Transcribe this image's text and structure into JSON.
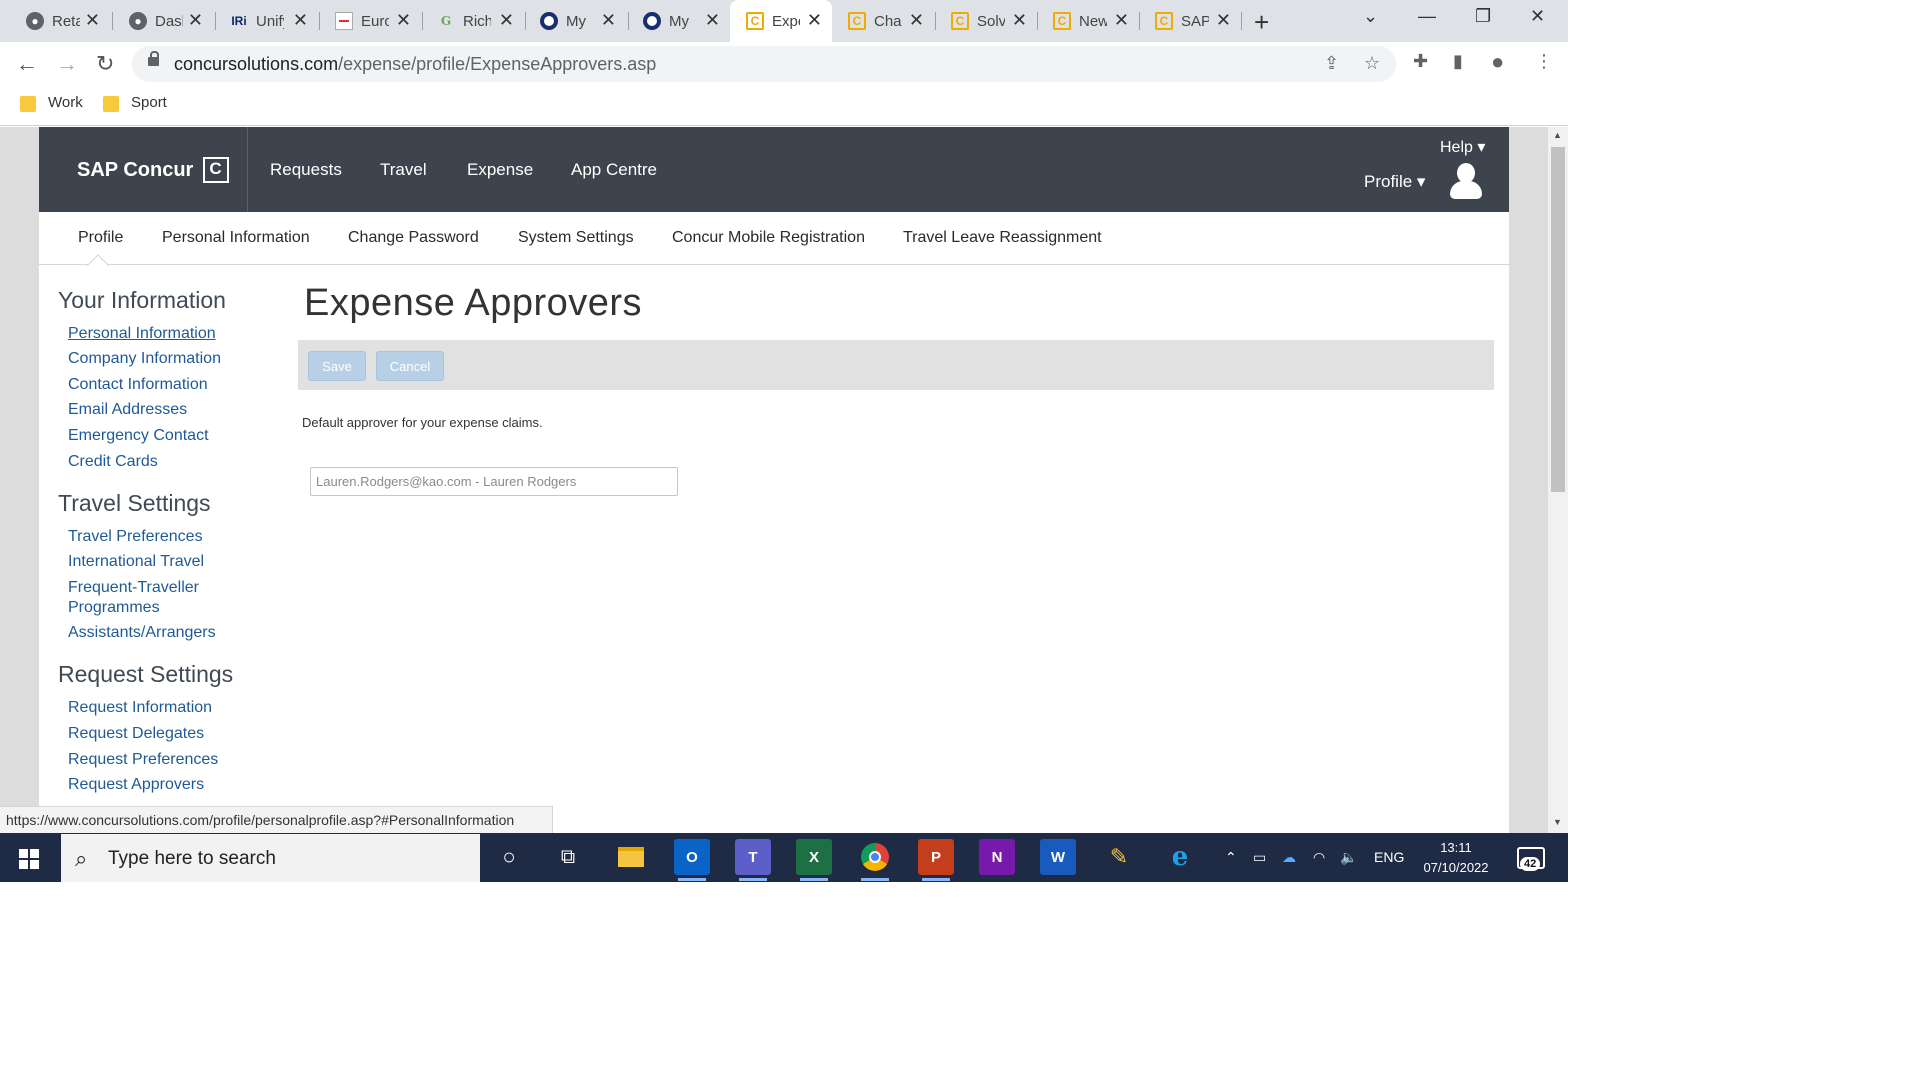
{
  "browser": {
    "tabs": [
      {
        "label": "Retail",
        "favicon": "globe-icon"
      },
      {
        "label": "Dashboard",
        "favicon": "globe-icon"
      },
      {
        "label": "Unify",
        "favicon": "iri-icon",
        "favicon_text": "IRi"
      },
      {
        "label": "Euro",
        "favicon": "document-icon"
      },
      {
        "label": "Rich",
        "favicon": "g-icon",
        "favicon_text": "G"
      },
      {
        "label": "My",
        "favicon": "ring-icon"
      },
      {
        "label": "My",
        "favicon": "ring-icon"
      },
      {
        "label": "Expense Approvers",
        "favicon": "concur-icon",
        "favicon_text": "C",
        "active": true
      },
      {
        "label": "Change",
        "favicon": "concur-icon",
        "favicon_text": "C"
      },
      {
        "label": "Solve",
        "favicon": "concur-icon",
        "favicon_text": "C"
      },
      {
        "label": "New",
        "favicon": "concur-icon",
        "favicon_text": "C"
      },
      {
        "label": "SAP",
        "favicon": "concur-icon",
        "favicon_text": "C"
      }
    ],
    "new_tab": "+",
    "close_glyph": "✕",
    "url_host": "concursolutions.com",
    "url_path": "/expense/profile/ExpenseApprovers.asp",
    "bookmarks": [
      {
        "label": "Work"
      },
      {
        "label": "Sport"
      }
    ],
    "status_url": "https://www.concursolutions.com/profile/personalprofile.asp?#PersonalInformation"
  },
  "app": {
    "brand": "SAP Concur",
    "main_nav": [
      "Requests",
      "Travel",
      "Expense",
      "App Centre"
    ],
    "help": "Help ▾",
    "profile": "Profile  ▾",
    "sub_nav": [
      "Profile",
      "Personal Information",
      "Change Password",
      "System Settings",
      "Concur Mobile Registration",
      "Travel Leave Reassignment"
    ],
    "sidebar": {
      "sections": [
        {
          "heading": "Your Information",
          "links": [
            "Personal Information",
            "Company Information",
            "Contact Information",
            "Email Addresses",
            "Emergency Contact",
            "Credit Cards"
          ]
        },
        {
          "heading": "Travel Settings",
          "links": [
            "Travel Preferences",
            "International Travel",
            "Frequent-Traveller",
            "Programmes",
            "Assistants/Arrangers"
          ]
        },
        {
          "heading": "Request Settings",
          "links": [
            "Request Information",
            "Request Delegates",
            "Request Preferences",
            "Request Approvers"
          ]
        }
      ]
    },
    "page_title": "Expense Approvers",
    "save_label": "Save",
    "cancel_label": "Cancel",
    "description": "Default approver for your expense claims.",
    "approver_value": "Lauren.Rodgers@kao.com - Lauren Rodgers"
  },
  "taskbar": {
    "search_placeholder": "Type here to search",
    "apps": [
      "cortana",
      "task-view",
      "file-explorer",
      "outlook",
      "teams",
      "excel",
      "chrome",
      "powerpoint",
      "onenote",
      "word",
      "pen",
      "internet-explorer"
    ],
    "language": "ENG",
    "time": "13:11",
    "date": "07/10/2022",
    "notification_count": "42"
  },
  "colors": {
    "concur_header": "#3d444d",
    "link": "#1f5a96",
    "button_disabled": "#b8d0e6",
    "taskbar": "#1f2a44"
  }
}
